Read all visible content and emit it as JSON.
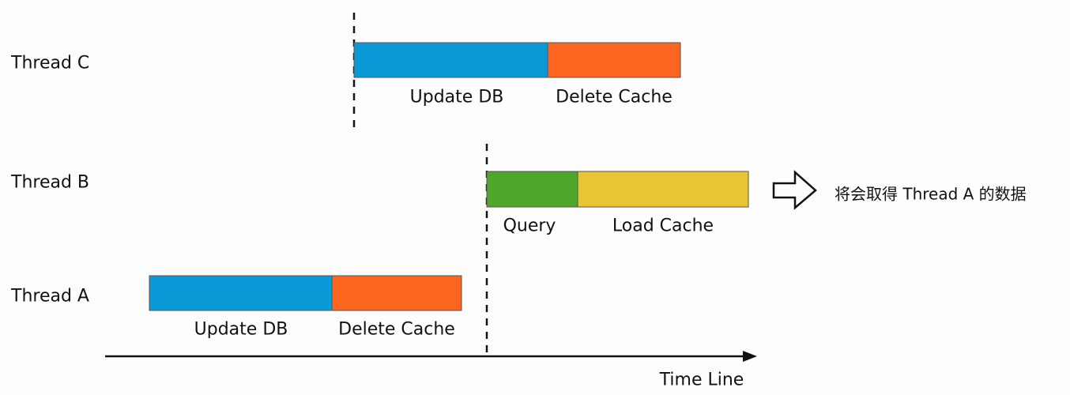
{
  "threads": {
    "c": {
      "label": "Thread C",
      "segments": [
        {
          "label": "Update DB",
          "color": "#0a9ad8"
        },
        {
          "label": "Delete Cache",
          "color": "#fb6520"
        }
      ]
    },
    "b": {
      "label": "Thread B",
      "segments": [
        {
          "label": "Query",
          "color": "#4ea72a"
        },
        {
          "label": "Load Cache",
          "color": "#e8c532"
        }
      ]
    },
    "a": {
      "label": "Thread A",
      "segments": [
        {
          "label": "Update DB",
          "color": "#0a9ad8"
        },
        {
          "label": "Delete Cache",
          "color": "#fb6520"
        }
      ]
    }
  },
  "axis": {
    "label": "Time Line"
  },
  "note": {
    "icon": "hollow-right-arrow-icon",
    "text": "将会取得 Thread A 的数据"
  }
}
